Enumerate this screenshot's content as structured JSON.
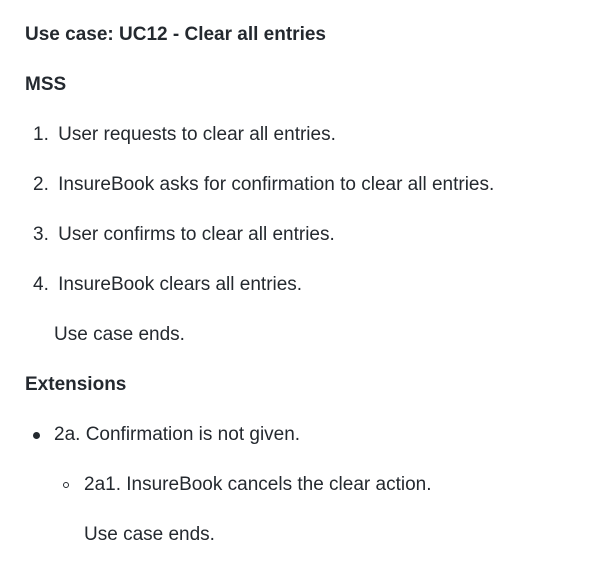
{
  "usecase": {
    "title": "Use case: UC12 - Clear all entries",
    "mss_heading": "MSS",
    "steps": [
      {
        "num": "1.",
        "text": "User requests to clear all entries."
      },
      {
        "num": "2.",
        "text": "InsureBook asks for confirmation to clear all entries."
      },
      {
        "num": "3.",
        "text": "User confirms to clear all entries."
      },
      {
        "num": "4.",
        "text": "InsureBook clears all entries."
      }
    ],
    "mss_end": "Use case ends.",
    "extensions_heading": "Extensions",
    "extensions": [
      {
        "text": "2a. Confirmation is not given.",
        "sub": [
          {
            "text": "2a1. InsureBook cancels the clear action."
          }
        ],
        "end": "Use case ends."
      }
    ]
  }
}
